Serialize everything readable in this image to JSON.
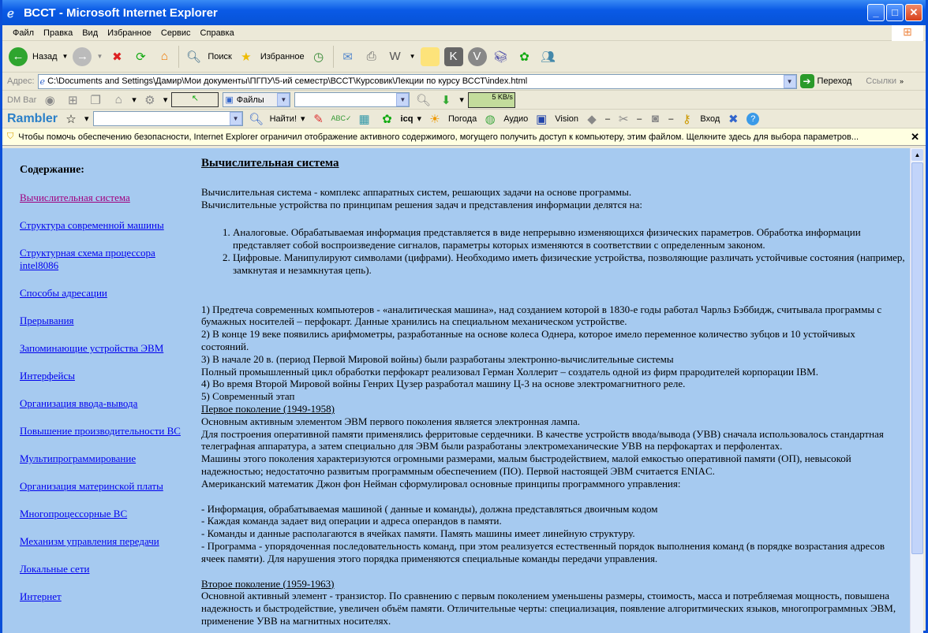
{
  "window": {
    "title": "ВССТ - Microsoft Internet Explorer"
  },
  "menu": [
    "Файл",
    "Правка",
    "Вид",
    "Избранное",
    "Сервис",
    "Справка"
  ],
  "toolbar": {
    "back": "Назад",
    "search": "Поиск",
    "favorites": "Избранное"
  },
  "address": {
    "label": "Адрес:",
    "value": "C:\\Documents and Settings\\Дамир\\Мои документы\\ПГПУ\\5-ий семестр\\ВССТ\\Курсовик\\Лекции по курсу ВССТ\\index.html",
    "go": "Переход",
    "links": "Ссылки"
  },
  "dmbar": {
    "label": "DM Bar",
    "files": "Файлы",
    "speed": "5 KB/s"
  },
  "rambler": {
    "logo": "Rambler",
    "find": "Найти!",
    "icq": "icq",
    "weather": "Погода",
    "audio": "Аудио",
    "vision": "Vision",
    "login": "Вход"
  },
  "infobar": {
    "text": "Чтобы помочь обеспечению безопасности, Internet Explorer ограничил отображение активного содержимого, могущего получить доступ к компьютеру, этим файлом. Щелкните здесь для выбора параметров..."
  },
  "nav": {
    "title": "Содержание:",
    "items": [
      "Вычислительная система",
      "Структура современной машины",
      "Структурная схема процессора intel8086",
      "Способы адресации",
      "Прерывания",
      "Запоминающие устройства ЭВМ",
      "Интерфейсы",
      "Организация ввода-вывода",
      "Повышение производительности ВС",
      "Мультипрограммирование",
      "Организация материнской платы",
      "Многопроцессорные ВС",
      "Механизм управления передачи",
      "Локальные сети",
      "Интернет"
    ]
  },
  "main": {
    "title": "Вычислительная система",
    "intro": [
      "Вычислительная система - комплекс аппаратных систем, решающих задачи на основе программы.",
      "Вычислительные устройства по принципам решения задач и представления информации делятся на:"
    ],
    "list": [
      "Аналоговые. Обрабатываемая информация представляется в виде непрерывно изменяющихся физических параметров. Обработка информации представляет собой воспроизведение сигналов, параметры которых изменяются в соответствии с определенным законом.",
      "Цифровые. Манипулируют символами (цифрами). Необходимо иметь физические устройства, позволяющие различать устойчивые состояния (например, замкнутая и незамкнутая цепь)."
    ],
    "history": [
      "1) Предтеча современных компьютеров - «аналитическая машина», над созданием которой в 1830-е годы работал Чарльз Бэббидж, считывала программы с бумажных носителей – перфокарт. Данные хранились на специальном механическом устройстве.",
      "2) В конце 19 веке появились арифмометры, разработанные на основе колеса Однера, которое имело переменное количество зубцов и 10 устойчивых состояний.",
      "3) В начале 20 в. (период Первой Мировой войны) были разработаны электронно-вычислительные системы",
      "Полный промышленный цикл обработки перфокарт реализовал Герман Холлерит – создатель одной из фирм прародителей корпорации IBM.",
      "4) Во время Второй Мировой войны Генрих Цузер разработал машину Ц-3 на основе электромагнитного реле.",
      "5) Современный этап"
    ],
    "gen1_title": "Первое поколение (1949-1958)",
    "gen1": [
      "Основным активным элементом ЭВМ первого поколения является электронная лампа.",
      "Для построения оперативной памяти применялись ферритовые сердечники. В качестве устройств ввода/вывода (УВВ) сначала использовалось стандартная телеграфная аппаратура, а затем специально для ЭВМ были разработаны электромеханические УВВ на перфокартах и перфолентах.",
      "Машины этого поколения характеризуются огромными размерами, малым быстродействием, малой емкостью оперативной памяти (ОП), невысокой надежностью; недостаточно развитым программным обеспечением (ПО). Первой настоящей ЭВМ считается ENIAC.",
      "Американский математик Джон фон Нейман сформулировал основные принципы программного управления:"
    ],
    "principles": [
      "- Информация, обрабатываемая машиной ( данные и команды), должна представляться двоичным кодом",
      "- Каждая команда задает вид операции и адреса операндов в памяти.",
      "- Команды и данные располагаются в ячейках памяти. Память машины имеет линейную структуру.",
      "- Программа - упорядоченная последовательность команд, при этом реализуется естественный порядок выполнения команд (в порядке возрастания адресов ячеек памяти). Для нарушения этого порядка применяются специальные команды передачи управления."
    ],
    "gen2_title": "Второе поколение (1959-1963)",
    "gen2": "Основной активный элемент - транзистор. По сравнению с первым поколением уменьшены размеры, стоимость, масса и потребляемая мощность, повышена надежность и быстродействие, увеличен объём памяти. Отличительные черты: специализация, появление алгоритмических языков, многопрограммных ЭВМ, применение УВВ на магнитных носителях."
  }
}
